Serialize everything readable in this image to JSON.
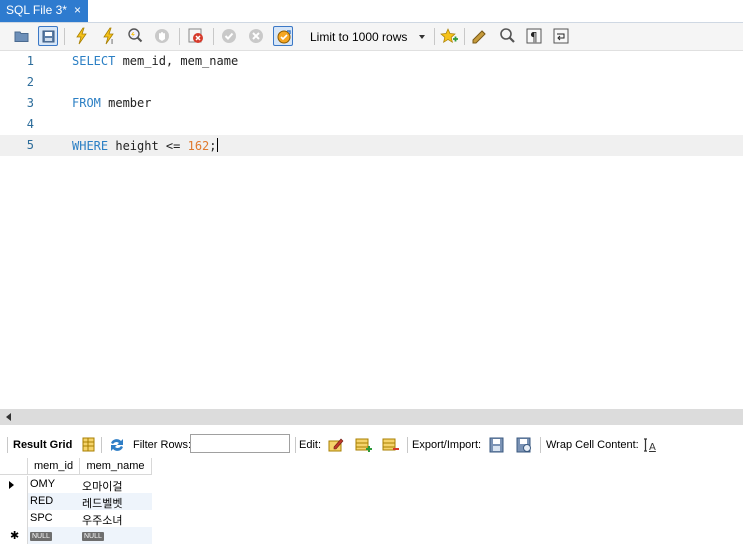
{
  "tab": {
    "title": "SQL File 3*",
    "close_glyph": "×"
  },
  "toolbar": {
    "buttons": [
      "open-file-icon",
      "save-icon",
      "execute-icon",
      "execute-current-icon",
      "explain-icon",
      "stop-icon",
      "toggle-error-icon",
      "commit-icon",
      "rollback-icon",
      "autocommit-icon",
      "bookmark-icon",
      "beautify-icon",
      "find-icon",
      "invisible-chars-icon",
      "wrap-icon"
    ],
    "limit_label": "Limit to 1000 rows"
  },
  "editor": {
    "lines": [
      {
        "num": "1",
        "keyword": "SELECT",
        "rest": " mem_id, mem_name",
        "number": "",
        "tail": ""
      },
      {
        "num": "2",
        "keyword": "",
        "rest": "",
        "number": "",
        "tail": ""
      },
      {
        "num": "3",
        "keyword": "FROM",
        "rest": " member",
        "number": "",
        "tail": ""
      },
      {
        "num": "4",
        "keyword": "",
        "rest": "",
        "number": "",
        "tail": ""
      },
      {
        "num": "5",
        "keyword": "WHERE",
        "rest": " height <= ",
        "number": "162",
        "tail": ";"
      }
    ]
  },
  "result_toolbar": {
    "result_grid_label": "Result Grid",
    "filter_rows_label": "Filter Rows:",
    "filter_value": "",
    "edit_label": "Edit:",
    "export_import_label": "Export/Import:",
    "wrap_label": "Wrap Cell Content:"
  },
  "grid": {
    "columns": [
      "mem_id",
      "mem_name"
    ],
    "rows": [
      {
        "mem_id": "OMY",
        "mem_name": "오마이걸"
      },
      {
        "mem_id": "RED",
        "mem_name": "레드벨벳"
      },
      {
        "mem_id": "SPC",
        "mem_name": "우주소녀"
      }
    ],
    "new_row_marker": "✱",
    "null_label": "NULL"
  },
  "colors": {
    "tab_active": "#2e7bcf",
    "keyword": "#2b7fc4",
    "number": "#e07a2e",
    "line_number": "#2c6c9a",
    "current_line": "#f0f0f0"
  }
}
